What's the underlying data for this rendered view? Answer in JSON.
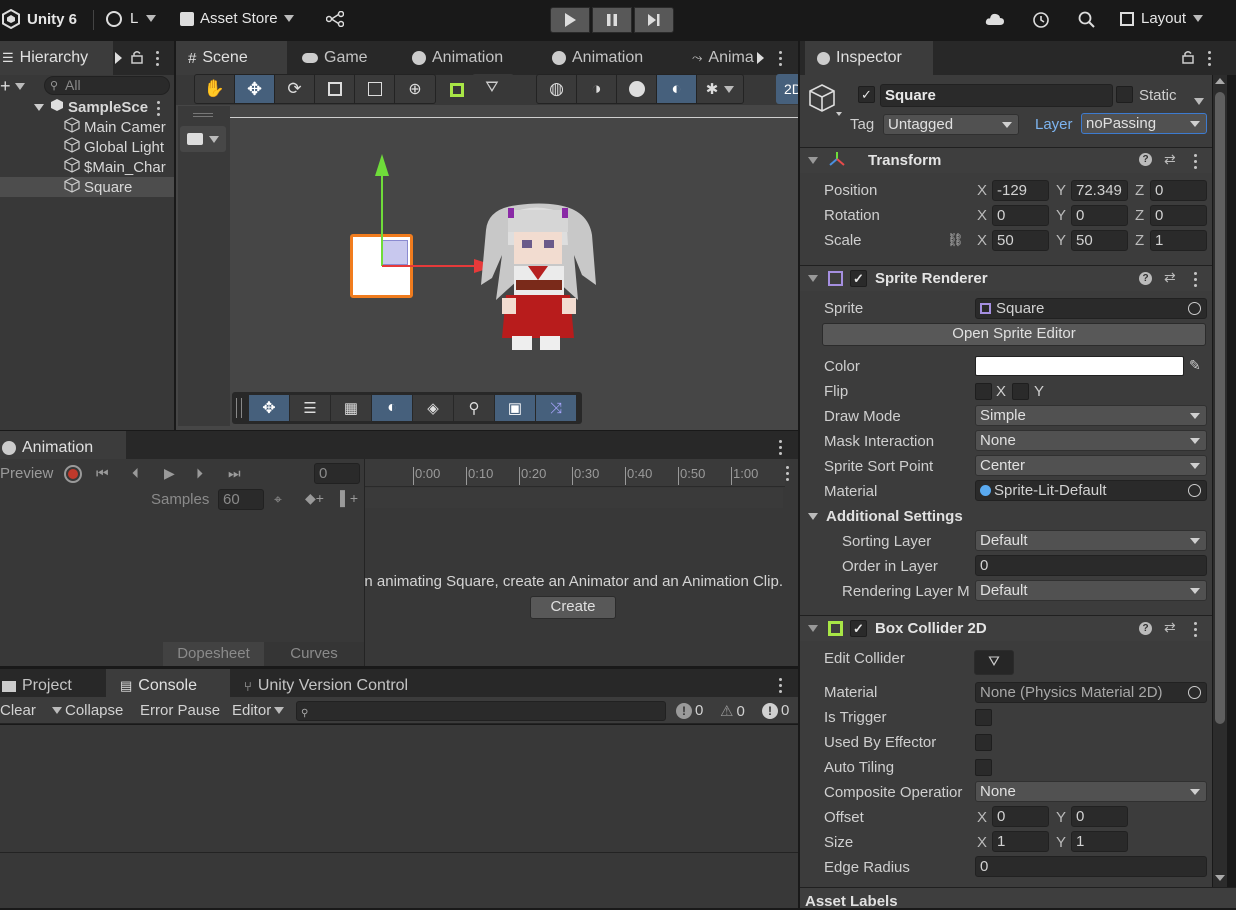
{
  "app": {
    "title": "Unity 6",
    "account": "L",
    "asset_store": "Asset Store",
    "layout": "Layout"
  },
  "tabs": {
    "hierarchy": "Hierarchy",
    "scene": "Scene",
    "game": "Game",
    "animation1": "Animation",
    "animation2": "Animation",
    "anim3": "Anima",
    "inspector": "Inspector",
    "animation_panel": "Animation",
    "project": "Project",
    "console": "Console",
    "uvc": "Unity Version Control"
  },
  "hierarchy": {
    "search_placeholder": "All",
    "scene": "SampleSce",
    "items": [
      "Main Camer",
      "Global Light",
      "$Main_Char",
      "Square"
    ]
  },
  "scene": {
    "mode_2d": "2D"
  },
  "animation": {
    "preview": "Preview",
    "frame": "0",
    "samples_label": "Samples",
    "samples": "60",
    "ticks": [
      "0:00",
      "0:10",
      "0:20",
      "0:30",
      "0:40",
      "0:50",
      "1:00"
    ],
    "message": "To begin animating Square, create an Animator and an Animation Clip.",
    "create": "Create",
    "dopesheet": "Dopesheet",
    "curves": "Curves"
  },
  "console": {
    "clear": "Clear",
    "collapse": "Collapse",
    "error_pause": "Error Pause",
    "editor": "Editor",
    "info_count": "0",
    "warn_count": "0",
    "error_count": "0"
  },
  "inspector": {
    "name": "Square",
    "static": "Static",
    "tag_label": "Tag",
    "tag": "Untagged",
    "layer_label": "Layer",
    "layer": "noPassing",
    "transform": {
      "title": "Transform",
      "position": "Position",
      "rotation": "Rotation",
      "scale": "Scale",
      "pos": {
        "x": "-129",
        "y": "72.349",
        "z": "0"
      },
      "rot": {
        "x": "0",
        "y": "0",
        "z": "0"
      },
      "scl": {
        "x": "50",
        "y": "50",
        "z": "1"
      }
    },
    "sprite_renderer": {
      "title": "Sprite Renderer",
      "sprite_label": "Sprite",
      "sprite": "Square",
      "open_editor": "Open Sprite Editor",
      "color_label": "Color",
      "flip_label": "Flip",
      "flip_x": "X",
      "flip_y": "Y",
      "draw_mode_label": "Draw Mode",
      "draw_mode": "Simple",
      "mask_label": "Mask Interaction",
      "mask": "None",
      "sort_point_label": "Sprite Sort Point",
      "sort_point": "Center",
      "material_label": "Material",
      "material": "Sprite-Lit-Default",
      "additional": "Additional Settings",
      "sorting_layer_label": "Sorting Layer",
      "sorting_layer": "Default",
      "order_label": "Order in Layer",
      "order": "0",
      "rendering_layer_label": "Rendering Layer M",
      "rendering_layer": "Default"
    },
    "box_collider": {
      "title": "Box Collider 2D",
      "edit_label": "Edit Collider",
      "material_label": "Material",
      "material": "None (Physics Material 2D)",
      "trigger_label": "Is Trigger",
      "effector_label": "Used By Effector",
      "tiling_label": "Auto Tiling",
      "composite_label": "Composite Operatior",
      "composite": "None",
      "offset_label": "Offset",
      "offset": {
        "x": "0",
        "y": "0"
      },
      "size_label": "Size",
      "size": {
        "x": "1",
        "y": "1"
      },
      "edge_label": "Edge Radius",
      "edge": "0"
    },
    "asset_labels": "Asset Labels"
  },
  "colors": {
    "selection": "#46607c",
    "accent_orange": "#f07c1e",
    "panel": "#383838",
    "dark": "#191919"
  }
}
